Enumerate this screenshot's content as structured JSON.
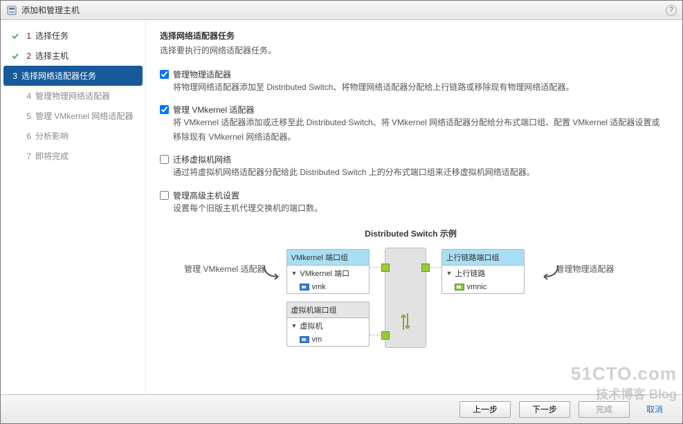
{
  "dialog": {
    "title": "添加和管理主机",
    "help_tooltip": "?"
  },
  "steps": [
    {
      "num": "1",
      "label": "选择任务",
      "state": "completed"
    },
    {
      "num": "2",
      "label": "选择主机",
      "state": "completed"
    },
    {
      "num": "3",
      "label": "选择网络适配器任务",
      "state": "active"
    },
    {
      "num": "4",
      "label": "管理物理网络适配器",
      "state": "future"
    },
    {
      "num": "5",
      "label": "管理 VMkernel 网络适配器",
      "state": "future"
    },
    {
      "num": "6",
      "label": "分析影响",
      "state": "future"
    },
    {
      "num": "7",
      "label": "即将完成",
      "state": "future"
    }
  ],
  "content": {
    "heading": "选择网络适配器任务",
    "subheading": "选择要执行的网络适配器任务。",
    "options": [
      {
        "checked": true,
        "label": "管理物理适配器",
        "desc": "将物理网络适配器添加至 Distributed Switch、将物理网络适配器分配给上行链路或移除现有物理网络适配器。"
      },
      {
        "checked": true,
        "label": "管理 VMkernel 适配器",
        "desc": "将 VMkernel 适配器添加或迁移至此 Distributed Switch、将 VMkernel 网络适配器分配给分布式端口组、配置 VMkernel 适配器设置或移除现有 VMkernel 网络适配器。"
      },
      {
        "checked": false,
        "label": "迁移虚拟机网络",
        "desc": "通过将虚拟机网络适配器分配给此 Distributed Switch 上的分布式端口组来迁移虚拟机网络适配器。"
      },
      {
        "checked": false,
        "label": "管理高级主机设置",
        "desc": "设置每个旧版主机代理交换机的端口数。"
      }
    ],
    "diagram": {
      "title": "Distributed Switch 示例",
      "hint_left": "管理 VMkernel 适配器",
      "hint_right": "管理物理适配器",
      "vmkernel_box": {
        "header": "VMkernel 端口组",
        "row1": "VMkernel 端口",
        "row2": "vmk"
      },
      "vm_box": {
        "header": "虚拟机端口组",
        "row1": "虚拟机",
        "row2": "vm"
      },
      "uplink_box": {
        "header": "上行链路端口组",
        "row1": "上行链路",
        "row2": "vmnic"
      }
    }
  },
  "buttons": {
    "back": "上一步",
    "next": "下一步",
    "finish": "完成",
    "cancel": "取消"
  },
  "watermark": {
    "line1": "51CTO.com",
    "line2": "技术博客 Blog"
  }
}
